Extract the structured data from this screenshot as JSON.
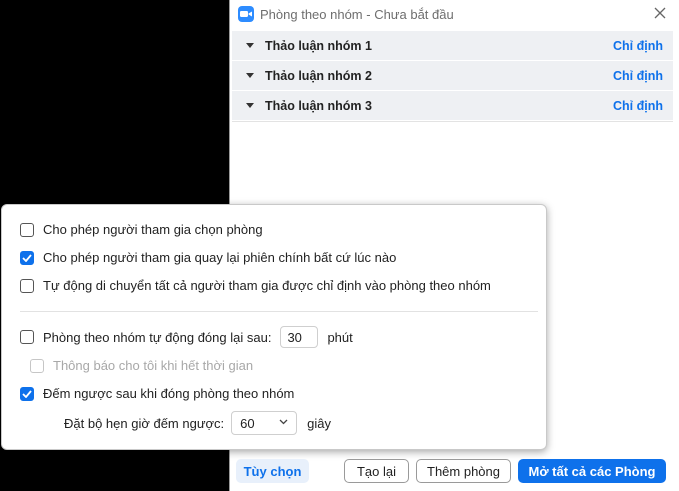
{
  "window": {
    "title": "Phòng theo nhóm - Chưa bắt đầu",
    "accent_color": "#0e71eb"
  },
  "rooms": [
    {
      "name": "Thảo luận nhóm 1",
      "action": "Chỉ định"
    },
    {
      "name": "Thảo luận nhóm 2",
      "action": "Chỉ định"
    },
    {
      "name": "Thảo luận nhóm 3",
      "action": "Chỉ định"
    }
  ],
  "options": {
    "allow_choose_room": {
      "label": "Cho phép người tham gia chọn phòng",
      "checked": false
    },
    "allow_return": {
      "label": "Cho phép người tham gia quay lại phiên chính bất cứ lúc nào",
      "checked": true
    },
    "auto_move": {
      "label": "Tự động di chuyển tất cả người tham gia được chỉ định vào phòng theo nhóm",
      "checked": false
    },
    "auto_close": {
      "label": "Phòng theo nhóm tự động đóng lại sau:",
      "checked": false,
      "value": "30",
      "unit": "phút"
    },
    "notify": {
      "label": "Thông báo cho tôi khi hết thời gian",
      "checked": false,
      "disabled": true
    },
    "countdown": {
      "label": "Đếm ngược sau khi đóng phòng theo nhóm",
      "checked": true
    },
    "countdown_timer": {
      "label": "Đặt bộ hẹn giờ đếm ngược:",
      "value": "60",
      "unit": "giây"
    }
  },
  "footer": {
    "options_label": "Tùy chọn",
    "recreate_label": "Tạo lại",
    "add_room_label": "Thêm phòng",
    "open_all_label": "Mở tất cả các Phòng"
  }
}
